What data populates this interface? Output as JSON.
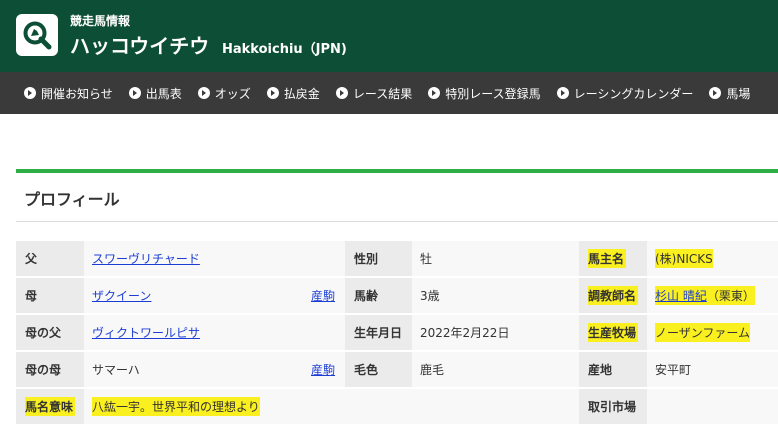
{
  "header": {
    "site_label": "競走馬情報",
    "horse_name": "ハッコウイチウ",
    "horse_name_english": "Hakkoichiu（JPN)",
    "logo_icon": "magnifier-horse-icon",
    "bg_color": "#0d4f36"
  },
  "nav": {
    "items": [
      {
        "label": "開催お知らせ"
      },
      {
        "label": "出馬表"
      },
      {
        "label": "オッズ"
      },
      {
        "label": "払戻金"
      },
      {
        "label": "レース結果"
      },
      {
        "label": "特別レース登録馬"
      },
      {
        "label": "レーシングカレンダー"
      },
      {
        "label": "馬場"
      }
    ]
  },
  "profile": {
    "title": "プロフィール",
    "accent_color": "#2eae44",
    "highlight_color": "#fbf01f",
    "rows": [
      {
        "c1_label": "父",
        "c1_value": "スワーヴリチャード",
        "c1_extra": "",
        "c2_label": "性別",
        "c2_value": "牡",
        "c3_label": "馬主名",
        "c3_value": "(株)NICKS"
      },
      {
        "c1_label": "母",
        "c1_value": "ザクイーン",
        "c1_extra": "産駒",
        "c2_label": "馬齢",
        "c2_value": "3歳",
        "c3_label": "調教師名",
        "c3_value": "杉山 晴紀",
        "c3_value_suffix": "（栗東）"
      },
      {
        "c1_label": "母の父",
        "c1_value": "ヴィクトワールピサ",
        "c1_extra": "",
        "c2_label": "生年月日",
        "c2_value": "2022年2月22日",
        "c3_label": "生産牧場",
        "c3_value": "ノーザンファーム"
      },
      {
        "c1_label": "母の母",
        "c1_value": "サマーハ",
        "c1_extra": "産駒",
        "c2_label": "毛色",
        "c2_value": "鹿毛",
        "c3_label": "産地",
        "c3_value": "安平町"
      },
      {
        "c1_label": "馬名意味",
        "c1_value": "八紘一宇。世界平和の理想より",
        "c3_label": "取引市場",
        "c3_value": ""
      }
    ]
  }
}
